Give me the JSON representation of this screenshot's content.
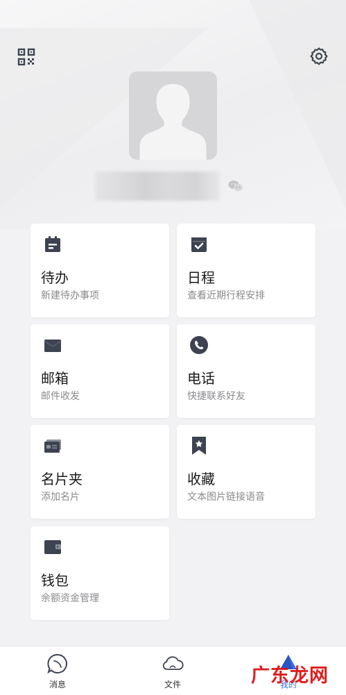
{
  "header": {
    "qr_icon": "qrcode-icon",
    "settings_icon": "gear-icon"
  },
  "profile": {
    "avatar_icon": "default-avatar",
    "name_hidden": true,
    "wechat_icon": "wechat-icon"
  },
  "cards": [
    {
      "id": "todo",
      "title": "待办",
      "subtitle": "新建待办事项",
      "icon": "calendar-todo-icon"
    },
    {
      "id": "schedule",
      "title": "日程",
      "subtitle": "查看近期行程安排",
      "icon": "calendar-check-icon"
    },
    {
      "id": "mail",
      "title": "邮箱",
      "subtitle": "邮件收发",
      "icon": "envelope-icon"
    },
    {
      "id": "phone",
      "title": "电话",
      "subtitle": "快捷联系好友",
      "icon": "phone-icon"
    },
    {
      "id": "cards",
      "title": "名片夹",
      "subtitle": "添加名片",
      "icon": "business-card-icon"
    },
    {
      "id": "favorites",
      "title": "收藏",
      "subtitle": "文本图片链接语音",
      "icon": "bookmark-star-icon"
    },
    {
      "id": "wallet",
      "title": "钱包",
      "subtitle": "余额资金管理",
      "icon": "wallet-icon"
    }
  ],
  "nav": {
    "items": [
      {
        "label": "消息",
        "icon": "chat-bubble-icon"
      },
      {
        "label": "文件",
        "icon": "cloud-icon"
      },
      {
        "label": "我的",
        "icon": "profile-icon",
        "active": true
      }
    ]
  },
  "watermark": {
    "text": "广东龙网"
  },
  "colors": {
    "icon": "#3d4350",
    "accent": "#3b6ee0",
    "watermark": "#dd1111"
  }
}
